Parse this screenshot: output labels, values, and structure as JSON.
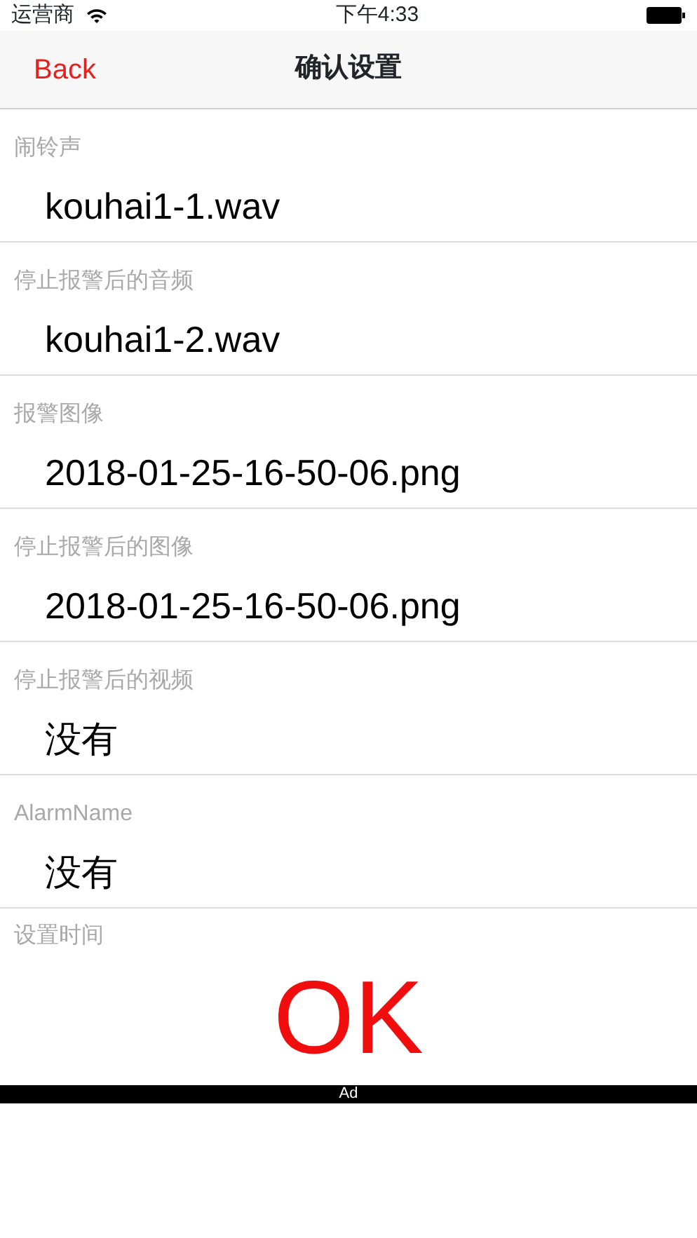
{
  "status_bar": {
    "carrier": "运营商",
    "time": "下午4:33"
  },
  "nav_bar": {
    "back": "Back",
    "title": "确认设置"
  },
  "fields": [
    {
      "label": "闹铃声",
      "value": "kouhai1-1.wav"
    },
    {
      "label": "停止报警后的音频",
      "value": "kouhai1-2.wav"
    },
    {
      "label": "报警图像",
      "value": "2018-01-25-16-50-06.png"
    },
    {
      "label": "停止报警后的图像",
      "value": "2018-01-25-16-50-06.png"
    },
    {
      "label": "停止报警后的视频",
      "value": "没有"
    },
    {
      "label": "AlarmName",
      "value": "没有"
    }
  ],
  "time_section": {
    "label": "设置时间",
    "button": "OK"
  },
  "ad_bar": {
    "label": "Ad"
  }
}
